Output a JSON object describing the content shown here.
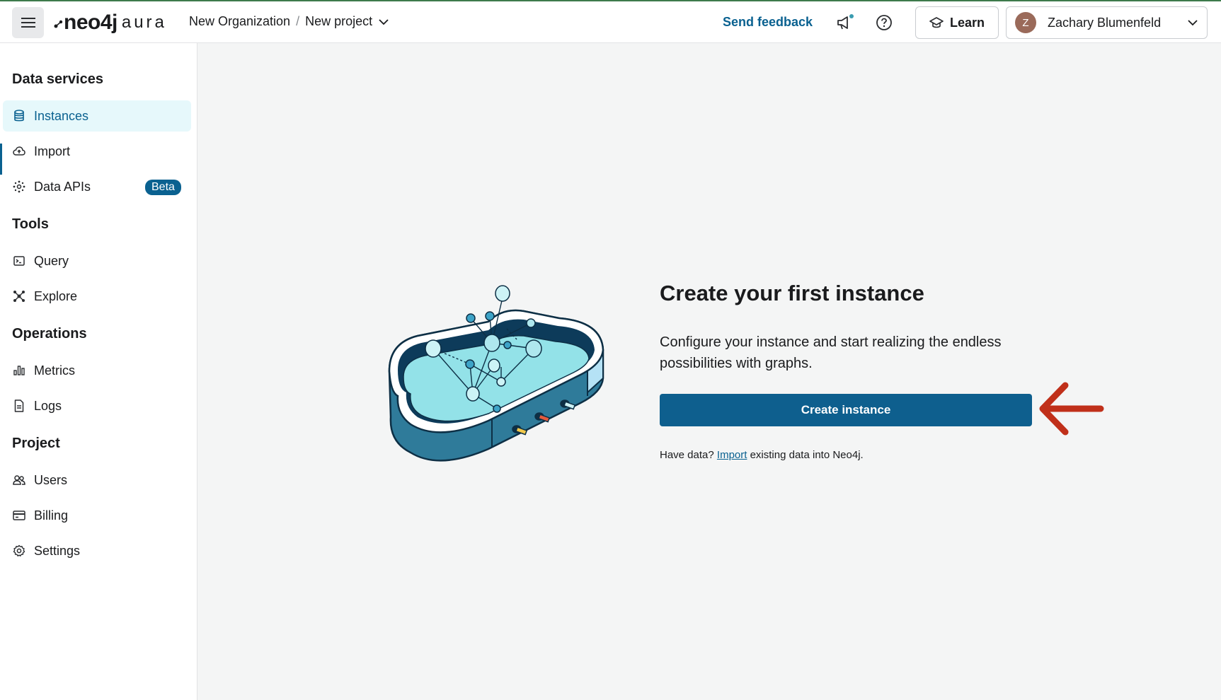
{
  "header": {
    "logo_main": "neo4j",
    "logo_sub": "aura",
    "breadcrumb_org": "New Organization",
    "breadcrumb_sep": "/",
    "breadcrumb_project": "New project",
    "send_feedback": "Send feedback",
    "learn_label": "Learn",
    "user_initial": "Z",
    "user_name": "Zachary Blumenfeld"
  },
  "sidebar": {
    "sections": [
      {
        "title": "Data services"
      },
      {
        "title": "Tools"
      },
      {
        "title": "Operations"
      },
      {
        "title": "Project"
      }
    ],
    "items": [
      {
        "label": "Instances",
        "icon": "database-icon"
      },
      {
        "label": "Import",
        "icon": "cloud-upload-icon"
      },
      {
        "label": "Data APIs",
        "icon": "data-api-icon",
        "badge": "Beta"
      },
      {
        "label": "Query",
        "icon": "terminal-icon"
      },
      {
        "label": "Explore",
        "icon": "graph-explore-icon"
      },
      {
        "label": "Metrics",
        "icon": "bar-chart-icon"
      },
      {
        "label": "Logs",
        "icon": "document-icon"
      },
      {
        "label": "Users",
        "icon": "users-icon"
      },
      {
        "label": "Billing",
        "icon": "credit-card-icon"
      },
      {
        "label": "Settings",
        "icon": "gear-icon"
      }
    ]
  },
  "main": {
    "headline": "Create your first instance",
    "description": "Configure your instance and start realizing the endless possibilities with graphs.",
    "create_button": "Create instance",
    "have_data_prefix": "Have data?",
    "import_link": "Import",
    "have_data_suffix": "existing data into Neo4j."
  },
  "colors": {
    "accent": "#0a6190",
    "button": "#0e5f8e",
    "active_bg": "#e6f8fb",
    "arrow": "#c0301a"
  }
}
